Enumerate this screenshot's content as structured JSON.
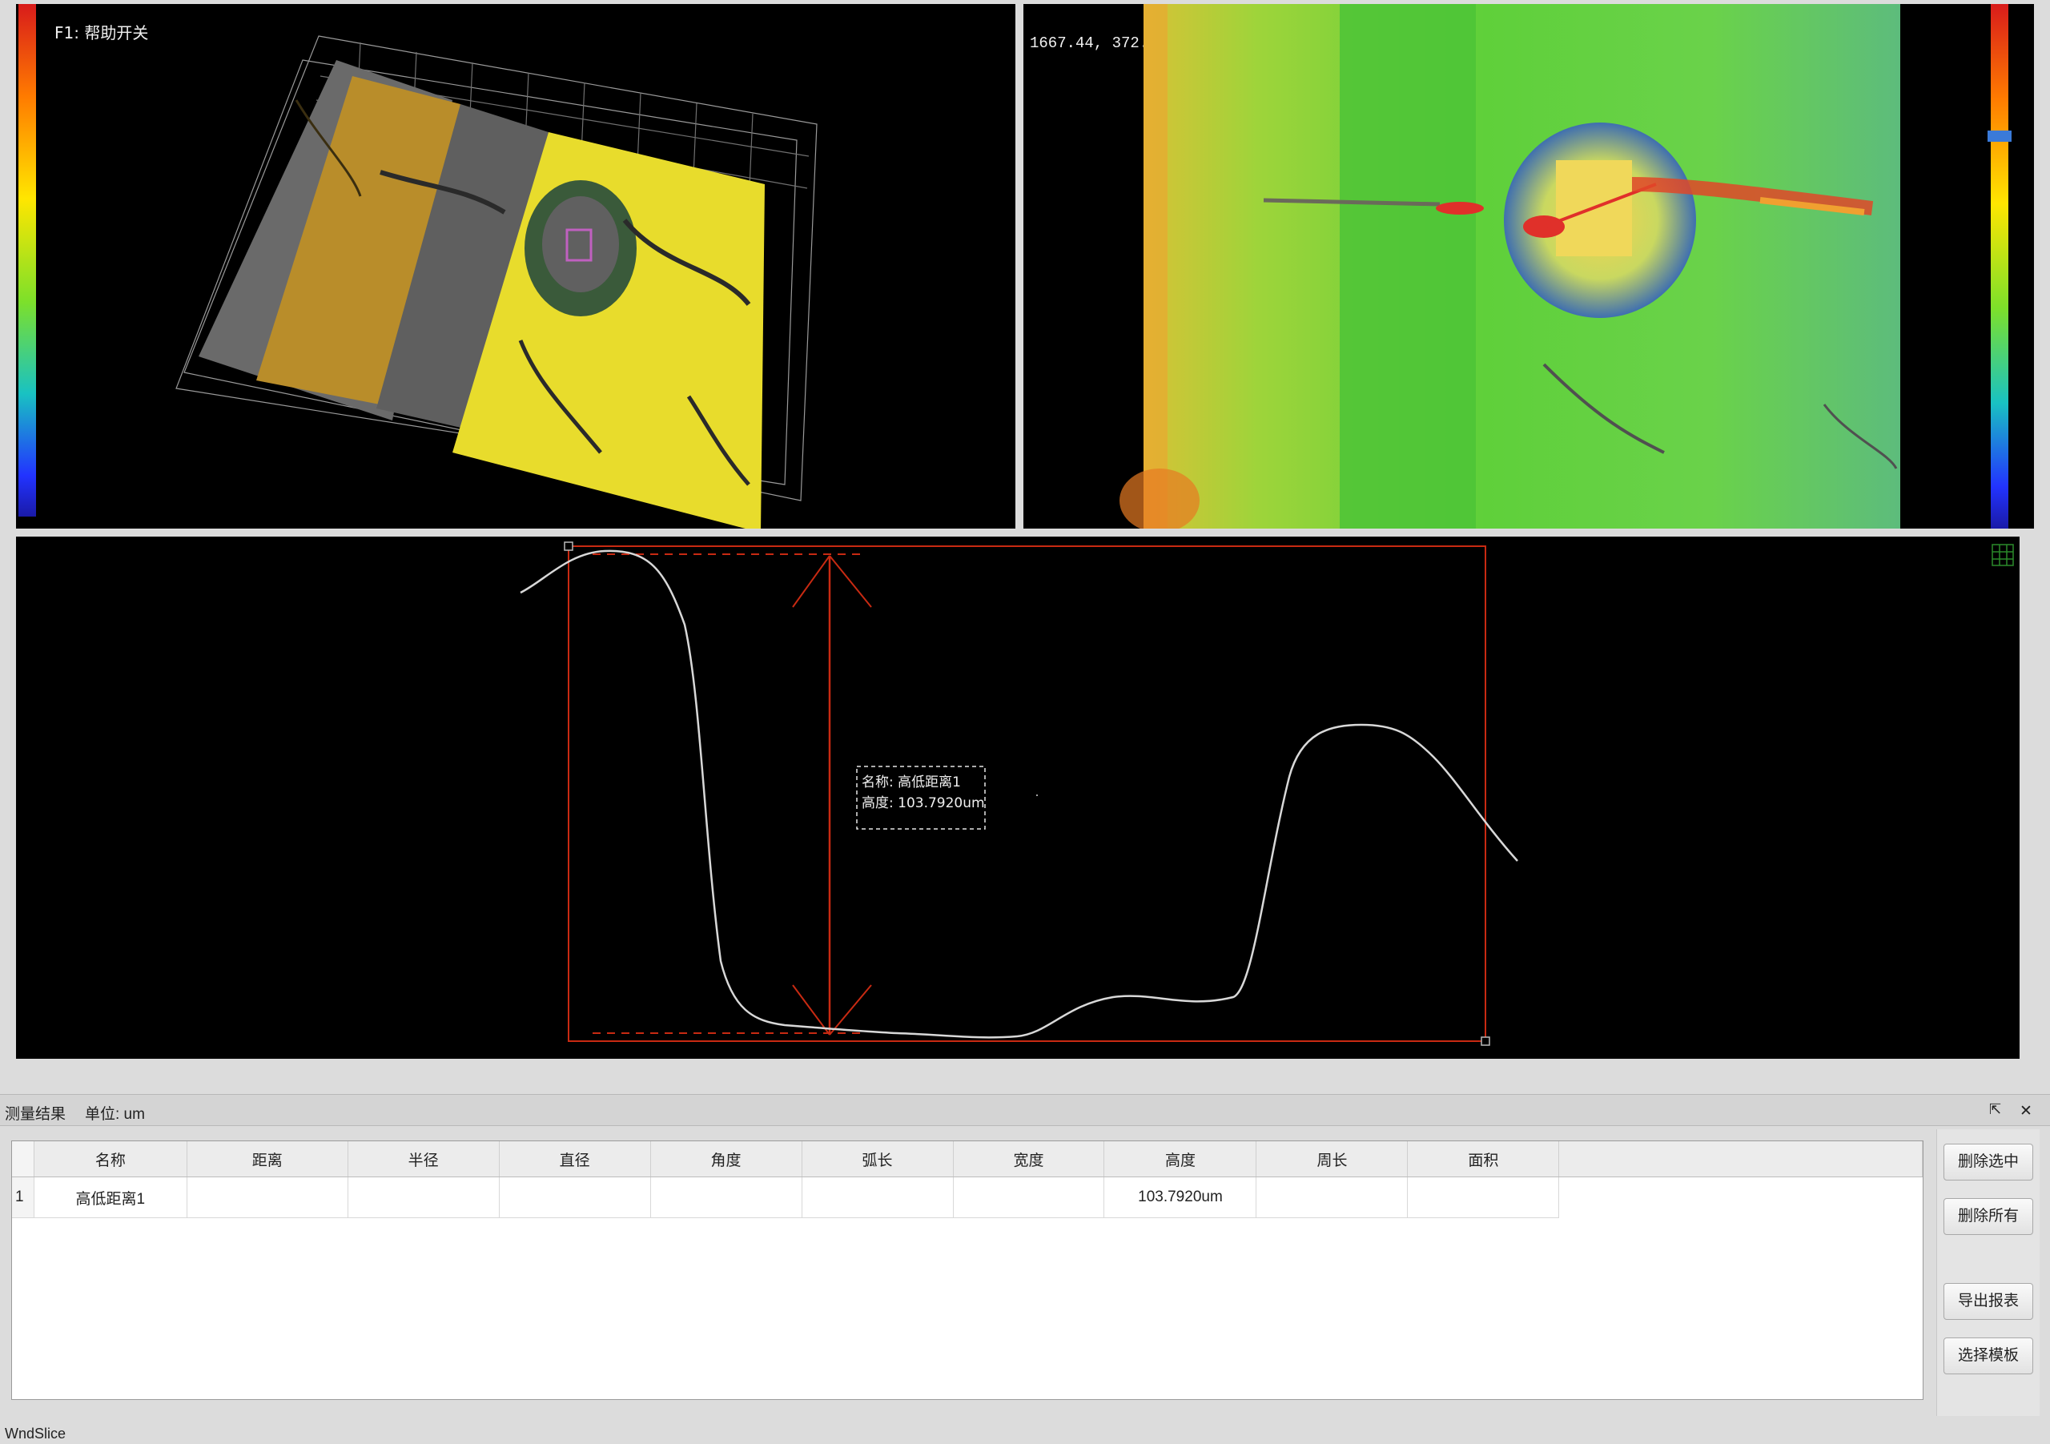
{
  "view3d": {
    "help_label": "F1: 帮助开关",
    "accent_colors": {
      "wood": "#c79a2c",
      "grey_band": "#6d6d6d",
      "yellow_plate": "#e9dd2a"
    }
  },
  "viewmap": {
    "coords_label": "1667.44, 372.62",
    "accent_colors": {
      "green": "#5fd03a",
      "yellow": "#f0e040",
      "red": "#e23020"
    }
  },
  "profile": {
    "annotation": {
      "name_line": "名称: 高低距离1",
      "height_line": "高度: 103.7920um"
    },
    "colors": {
      "curve": "#d8d8d8",
      "measure": "#c82a12"
    }
  },
  "results": {
    "title": "测量结果",
    "unit_label": "单位: um",
    "pin_icon": "pin-icon",
    "close_icon": "close-icon",
    "columns": [
      "名称",
      "距离",
      "半径",
      "直径",
      "角度",
      "弧长",
      "宽度",
      "高度",
      "周长",
      "面积"
    ],
    "rows": [
      {
        "index": "1",
        "cells": [
          "高低距离1",
          "",
          "",
          "",
          "",
          "",
          "",
          "103.7920um",
          "",
          ""
        ]
      }
    ]
  },
  "buttons": {
    "delete_selected": "删除选中",
    "delete_all": "删除所有",
    "export_report": "导出报表",
    "select_template": "选择模板"
  },
  "status": {
    "text": "WndSlice"
  }
}
